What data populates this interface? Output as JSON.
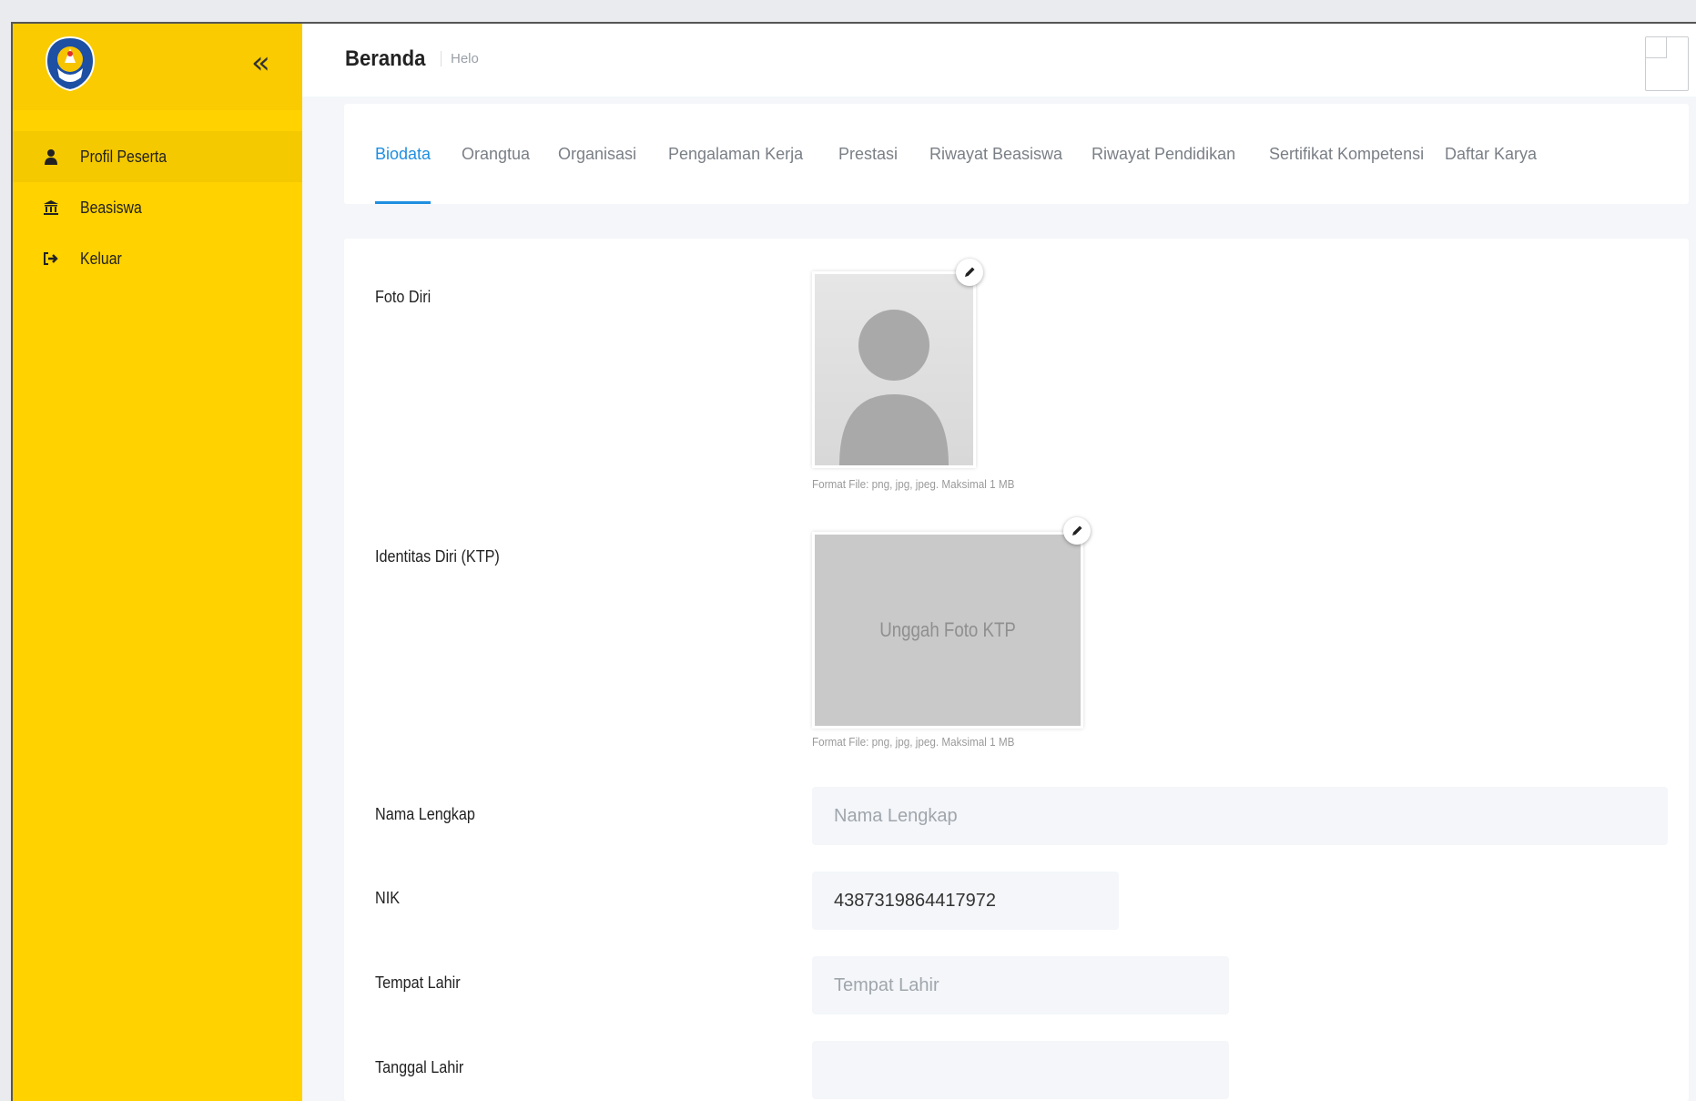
{
  "sidebar": {
    "items": [
      {
        "label": "Profil Peserta",
        "icon": "user-icon",
        "active": true
      },
      {
        "label": "Beasiswa",
        "icon": "bank-icon",
        "active": false
      },
      {
        "label": "Keluar",
        "icon": "sign-out-icon",
        "active": false
      }
    ]
  },
  "header": {
    "title": "Beranda",
    "breadcrumb": "Helo"
  },
  "tabs": [
    {
      "label": "Biodata",
      "active": true
    },
    {
      "label": "Orangtua",
      "active": false
    },
    {
      "label": "Organisasi",
      "active": false
    },
    {
      "label": "Pengalaman Kerja",
      "active": false
    },
    {
      "label": "Prestasi",
      "active": false
    },
    {
      "label": "Riwayat Beasiswa",
      "active": false
    },
    {
      "label": "Riwayat Pendidikan",
      "active": false
    },
    {
      "label": "Sertifikat Kompetensi",
      "active": false
    },
    {
      "label": "Daftar Karya",
      "active": false
    }
  ],
  "form": {
    "foto_label": "Foto Diri",
    "foto_hint": "Format File: png, jpg, jpeg. Maksimal 1 MB",
    "ktp_label": "Identitas Diri (KTP)",
    "ktp_placeholder": "Unggah Foto KTP",
    "ktp_hint": "Format File: png, jpg, jpeg. Maksimal 1 MB",
    "nama": {
      "label": "Nama Lengkap",
      "value": "",
      "placeholder": "Nama Lengkap"
    },
    "nik": {
      "label": "NIK",
      "value": "4387319864417972",
      "placeholder": ""
    },
    "tempat_lahir": {
      "label": "Tempat Lahir",
      "value": "",
      "placeholder": "Tempat Lahir"
    },
    "tanggal_lahir": {
      "label": "Tanggal Lahir",
      "value": "",
      "placeholder": ""
    }
  },
  "colors": {
    "sidebar": "#ffd200",
    "accent": "#1f8fe0"
  }
}
